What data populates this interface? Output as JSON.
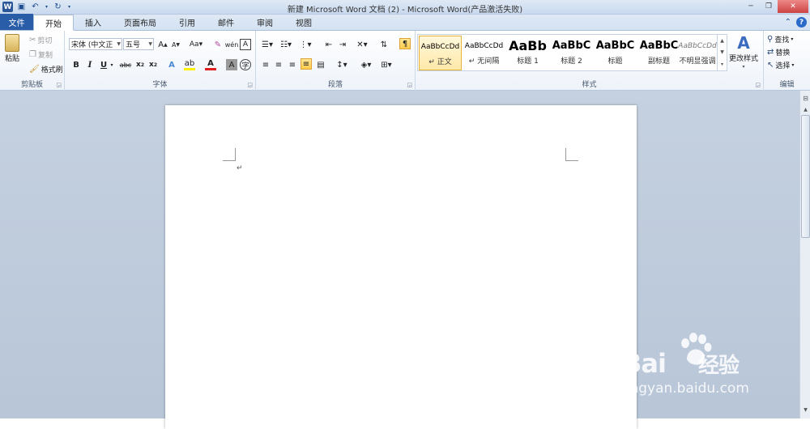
{
  "window": {
    "title": "新建 Microsoft Word 文档 (2)  -  Microsoft Word(产品激活失败)"
  },
  "tabs": [
    {
      "label": "文件"
    },
    {
      "label": "开始"
    },
    {
      "label": "插入"
    },
    {
      "label": "页面布局"
    },
    {
      "label": "引用"
    },
    {
      "label": "邮件"
    },
    {
      "label": "审阅"
    },
    {
      "label": "视图"
    }
  ],
  "clipboard": {
    "paste": "粘贴",
    "cut": "剪切",
    "copy": "复制",
    "format_painter": "格式刷",
    "group_label": "剪贴板"
  },
  "font": {
    "font_name": "宋体 (中文正",
    "font_size": "五号",
    "group_label": "字体"
  },
  "paragraph": {
    "group_label": "段落"
  },
  "styles": {
    "items": [
      {
        "sample": "AaBbCcDd",
        "name": "↵ 正文"
      },
      {
        "sample": "AaBbCcDd",
        "name": "↵ 无间隔"
      },
      {
        "sample": "AaBb",
        "name": "标题 1"
      },
      {
        "sample": "AaBbC",
        "name": "标题 2"
      },
      {
        "sample": "AaBbC",
        "name": "标题"
      },
      {
        "sample": "AaBbC",
        "name": "副标题"
      },
      {
        "sample": "AaBbCcDd",
        "name": "不明显强调"
      }
    ],
    "change_styles": "更改样式",
    "group_label": "样式"
  },
  "editing": {
    "find": "查找",
    "replace": "替换",
    "select": "选择",
    "group_label": "编辑"
  },
  "watermark": {
    "brand": "Bai",
    "brand2": "经验",
    "url": "jingyan.baidu.com"
  }
}
